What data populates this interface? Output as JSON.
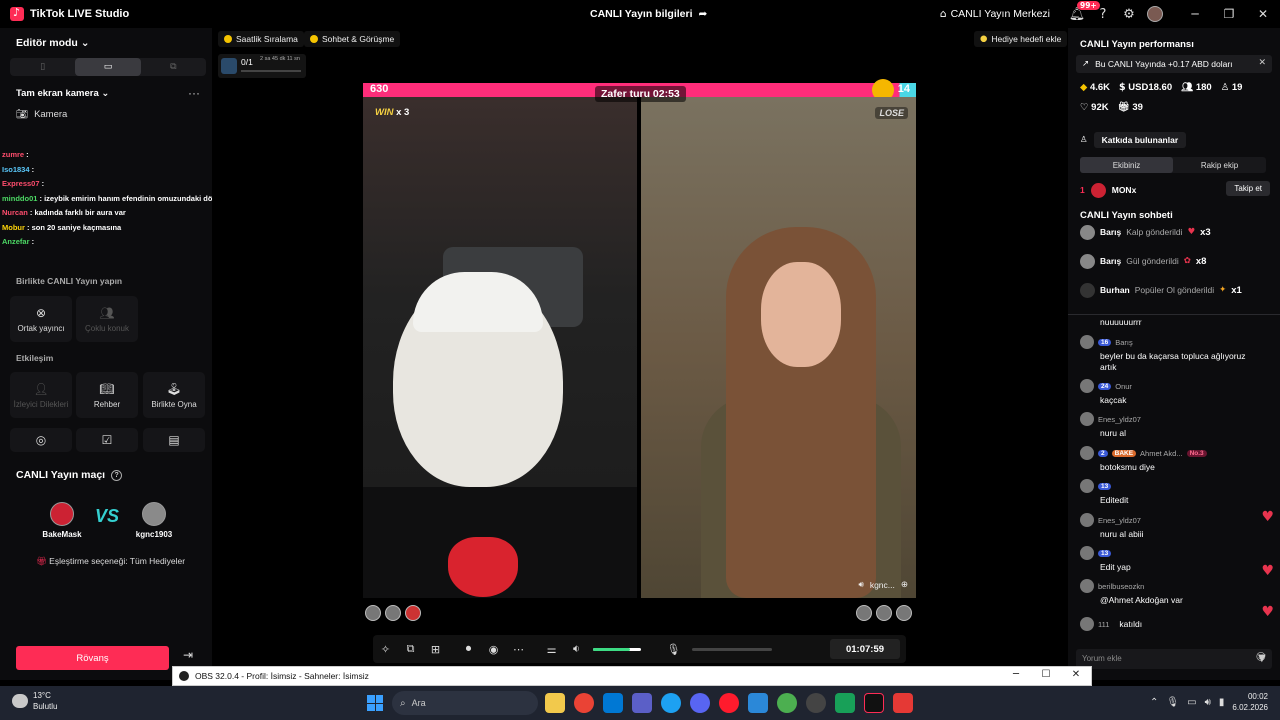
{
  "titlebar": {
    "app_name": "TikTok LIVE Studio",
    "center_title": "CANLI Yayın bilgileri",
    "live_center": "CANLI Yayın Merkezi",
    "notif_badge": "99+"
  },
  "left": {
    "editor_mode": "Editör modu",
    "source_title": "Tam ekran kamera",
    "camera_label": "Kamera",
    "overlay_chat": [
      {
        "user": "zumre",
        "text": ""
      },
      {
        "user": "Iso1834",
        "text": ""
      },
      {
        "user": "Express07",
        "text": ""
      },
      {
        "user": "minddo01",
        "text": "izeybik emirim hanım efendinin omuzundaki dövmeyi görebilir miyiz"
      },
      {
        "user": "Nurcan",
        "text": "kadında farklı bir aura var"
      },
      {
        "user": "Mobur",
        "text": "son 20 saniye kaçmasına"
      },
      {
        "user": "Anzefar",
        "text": ""
      }
    ],
    "section_together": "Birlikte CANLI Yayın yapın",
    "tile_cohost": "Ortak yayıncı",
    "tile_multi": "Çoklu konuk",
    "section_interaction": "Etkileşim",
    "tile_viewer_requests": "İzleyici Dilekleri",
    "tile_guide": "Rehber",
    "tile_play_together": "Birlikte Oyna",
    "match_title": "CANLI Yayın maçı",
    "player_left": "BakeMask",
    "player_right": "kgnc1903",
    "vs": "VS",
    "match_option": "Eşleştirme seçeneği: Tüm Hediyeler",
    "rematch": "Rövanş"
  },
  "center": {
    "chip_hourly": "Saatlik Sıralama",
    "chip_chat": "Sohbet & Görüşme",
    "goal": "Hediye hedefi ekle",
    "task_count": "0/1",
    "task_time": "2 sa 45 dk 11 sn",
    "score_left": "630",
    "score_right": "14",
    "round_label": "Zafer turu 02:53",
    "win_label": "WIN",
    "win_mult": "x 3",
    "lose_label": "LOSE",
    "opponent_name": "kgnc...",
    "volume_level": 0.78,
    "timer": "01:07:59"
  },
  "right": {
    "title": "CANLI Yayın performansı",
    "banner": "Bu CANLI Yayında +0.17 ABD doları",
    "stat_diamonds": "4.6K",
    "stat_usd": "USD18.60",
    "stat_viewers": "180",
    "stat_new": "19",
    "stat_likes": "92K",
    "stat_gifters": "39",
    "contributors": "Katkıda bulunanlar",
    "tab_team": "Ekibiniz",
    "tab_rival": "Rakip ekip",
    "rank_1_name": "MONx",
    "rank_1_num": "1",
    "follow": "Takip et",
    "chat_title": "CANLI Yayın sohbeti",
    "gifts": [
      {
        "user": "Barış",
        "action": "Kalp gönderildi",
        "mult": "x3"
      },
      {
        "user": "Barış",
        "action": "Gül gönderildi",
        "mult": "x8"
      },
      {
        "user": "Burhan",
        "action": "Popüler Ol gönderildi",
        "mult": "x1"
      }
    ],
    "messages": [
      {
        "user": "",
        "level": "",
        "text": "nuuuuuurrr"
      },
      {
        "user": "Barış",
        "level": "16",
        "text": "beyler bu da kaçarsa topluca ağlıyoruz artık"
      },
      {
        "user": "Onur",
        "level": "24",
        "text": "kaçcak"
      },
      {
        "user": "Enes_yldz07",
        "level": "",
        "text": "nuru al"
      },
      {
        "user": "Ahmet Akd...",
        "level": "2",
        "text": "botoksmu diye"
      },
      {
        "user": "",
        "level": "13",
        "text": "Editedit"
      },
      {
        "user": "Enes_yldz07",
        "level": "",
        "text": "nuru al abiii"
      },
      {
        "user": "",
        "level": "13",
        "text": "Edit yap"
      },
      {
        "user": "berilbuseozkn",
        "level": "",
        "text": "@Ahmet Akdoğan var"
      },
      {
        "user": "111",
        "level": "",
        "text": "katıldı"
      }
    ],
    "comment_placeholder": "Yorum ekle"
  },
  "obs": {
    "title": "OBS 32.0.4 - Profil: İsimsiz - Sahneler: İsimsiz"
  },
  "taskbar": {
    "temp": "13°C",
    "weather": "Bulutlu",
    "search": "Ara",
    "time": "00:02",
    "date": "6.02.2026"
  },
  "colors": {
    "accent": "#fe2c55",
    "score_pink": "#ff2d7a",
    "score_blue": "#4ad7e6",
    "vol_green": "#3ddc84"
  }
}
